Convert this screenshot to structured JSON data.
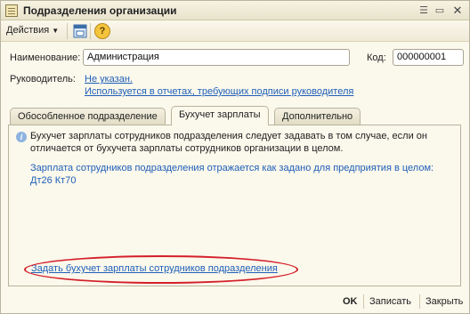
{
  "window": {
    "title": "Подразделения организации"
  },
  "toolbar": {
    "actions_label": "Действия",
    "help_symbol": "?"
  },
  "form": {
    "name_label": "Наименование:",
    "name_value": "Администрация",
    "code_label": "Код:",
    "code_value": "000000001",
    "manager_label": "Руководитель:",
    "manager_link": "Не указан.",
    "manager_hint": "Используется в отчетах, требующих подписи руководителя"
  },
  "tabs": [
    {
      "label": "Обособленное подразделение"
    },
    {
      "label": "Бухучет зарплаты"
    },
    {
      "label": "Дополнительно"
    }
  ],
  "panel": {
    "info_line1": "Бухучет зарплаты сотрудников подразделения следует задавать в том случае, если он",
    "info_line2": "отличается от бухучета зарплаты сотрудников организации в целом.",
    "accounting_line1": "Зарплата сотрудников подразделения отражается как задано для предприятия в целом:",
    "accounting_line2": "Дт26 Кт70",
    "set_link": "Задать бухучет зарплаты сотрудников подразделения"
  },
  "footer": {
    "ok_label": "OK",
    "save_label": "Записать",
    "close_label": "Закрыть"
  },
  "colors": {
    "link": "#1f5fb8",
    "highlight": "#d4202a",
    "background": "#fbf8ec"
  }
}
